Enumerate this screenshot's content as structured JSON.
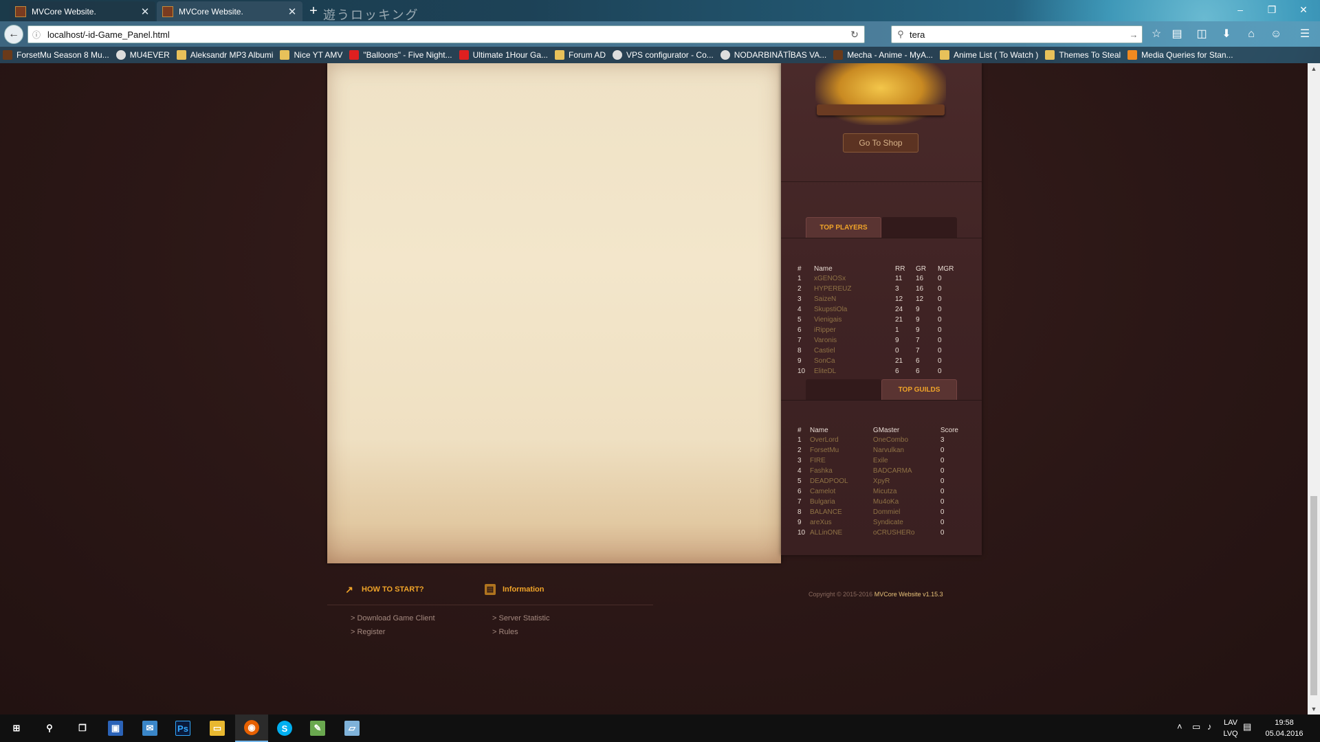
{
  "browser": {
    "tabs": [
      {
        "title": "MVCore Website."
      },
      {
        "title": "MVCore Website."
      }
    ],
    "tab_decoration_text": "遊うロッキング",
    "url": "localhost/-id-Game_Panel.html",
    "search_value": "tera",
    "bookmarks": [
      {
        "label": "ForsetMu Season 8 Mu...",
        "icon": "game-favicon"
      },
      {
        "label": "MU4EVER",
        "icon": "globe-icon"
      },
      {
        "label": "Aleksandr MP3 Albumi",
        "icon": "folder-icon"
      },
      {
        "label": "Nice YT AMV",
        "icon": "folder-icon"
      },
      {
        "label": "\"Balloons\" - Five Night...",
        "icon": "youtube-icon"
      },
      {
        "label": "Ultimate 1Hour Ga...",
        "icon": "youtube-icon"
      },
      {
        "label": "Forum AD",
        "icon": "folder-icon"
      },
      {
        "label": "VPS configurator - Co...",
        "icon": "moon-icon"
      },
      {
        "label": "NODARBINĀTĪBAS VA...",
        "icon": "building-icon"
      },
      {
        "label": "Mecha - Anime - MyA...",
        "icon": "mal-icon"
      },
      {
        "label": "Anime List ( To Watch )",
        "icon": "folder-icon"
      },
      {
        "label": "Themes To Steal",
        "icon": "folder-icon"
      },
      {
        "label": "Media Queries for Stan...",
        "icon": "star-icon"
      }
    ]
  },
  "sidebar": {
    "shop_button": "Go To Shop",
    "players_tab": "TOP PLAYERS",
    "guilds_tab": "TOP GUILDS",
    "players_headers": [
      "#",
      "Name",
      "RR",
      "GR",
      "MGR"
    ],
    "players": [
      {
        "rank": "1",
        "name": "xGENOSx",
        "rr": "11",
        "gr": "16",
        "mgr": "0"
      },
      {
        "rank": "2",
        "name": "HYPEREUZ",
        "rr": "3",
        "gr": "16",
        "mgr": "0"
      },
      {
        "rank": "3",
        "name": "SaizeN",
        "rr": "12",
        "gr": "12",
        "mgr": "0"
      },
      {
        "rank": "4",
        "name": "SkupstiOla",
        "rr": "24",
        "gr": "9",
        "mgr": "0"
      },
      {
        "rank": "5",
        "name": "Vienigais",
        "rr": "21",
        "gr": "9",
        "mgr": "0"
      },
      {
        "rank": "6",
        "name": "iRipper",
        "rr": "1",
        "gr": "9",
        "mgr": "0"
      },
      {
        "rank": "7",
        "name": "Varonis",
        "rr": "9",
        "gr": "7",
        "mgr": "0"
      },
      {
        "rank": "8",
        "name": "Castiel",
        "rr": "0",
        "gr": "7",
        "mgr": "0"
      },
      {
        "rank": "9",
        "name": "SonCa",
        "rr": "21",
        "gr": "6",
        "mgr": "0"
      },
      {
        "rank": "10",
        "name": "EliteDL",
        "rr": "6",
        "gr": "6",
        "mgr": "0"
      }
    ],
    "guilds_headers": [
      "#",
      "Name",
      "GMaster",
      "Score"
    ],
    "guilds": [
      {
        "rank": "1",
        "name": "OverLord",
        "master": "OneCombo",
        "score": "3"
      },
      {
        "rank": "2",
        "name": "ForsetMu",
        "master": "Narvulkan",
        "score": "0"
      },
      {
        "rank": "3",
        "name": "FIRE",
        "master": "Exile",
        "score": "0"
      },
      {
        "rank": "4",
        "name": "Fashka",
        "master": "BADCARMA",
        "score": "0"
      },
      {
        "rank": "5",
        "name": "DEADPOOL",
        "master": "XpyR",
        "score": "0"
      },
      {
        "rank": "6",
        "name": "Camelot",
        "master": "Micutza",
        "score": "0"
      },
      {
        "rank": "7",
        "name": "Bulgaria",
        "master": "Mu4oKa",
        "score": "0"
      },
      {
        "rank": "8",
        "name": "BALANCE",
        "master": "Dommiel",
        "score": "0"
      },
      {
        "rank": "9",
        "name": "areXus",
        "master": "Syndicate",
        "score": "0"
      },
      {
        "rank": "10",
        "name": "ALLinONE",
        "master": "oCRUSHERo",
        "score": "0"
      }
    ]
  },
  "footer": {
    "how_to_start": "HOW TO START?",
    "information": "Information",
    "links_left": [
      "> Download Game Client",
      "> Register"
    ],
    "links_right": [
      "> Server Statistic",
      "> Rules"
    ],
    "copyright_prefix": "Copyright © 2015-2016",
    "copyright_brand": "MVCore Website v1.15.3"
  },
  "taskbar": {
    "language": "LAV",
    "language_sub": "LVQ",
    "time": "19:58",
    "date": "05.04.2016"
  },
  "colors": {
    "accent": "#f0a429",
    "link_gold": "#8f7245",
    "page_bg": "#2b1716",
    "paper": "#f3e6cb"
  }
}
